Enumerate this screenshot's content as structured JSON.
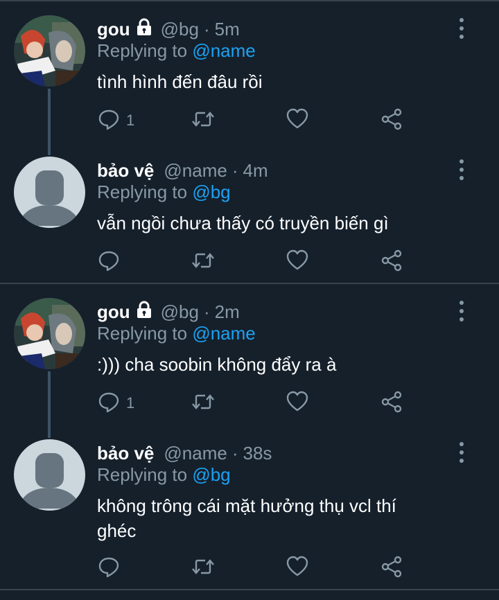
{
  "tweets": [
    {
      "name": "gou",
      "locked": true,
      "avatar": "anime-avatar",
      "handle": "@bg",
      "time": "5m",
      "replying_prefix": "Replying to",
      "replying_to": "@name",
      "text": "tình hình đến đâu rồi",
      "reply_count": "1"
    },
    {
      "name": "bảo vệ",
      "locked": false,
      "avatar": "default-avatar",
      "handle": "@name",
      "time": "4m",
      "replying_prefix": "Replying to",
      "replying_to": "@bg",
      "text": "vẫn ngồi chưa thấy có truyền biến gì",
      "reply_count": ""
    },
    {
      "name": "gou",
      "locked": true,
      "avatar": "anime-avatar",
      "handle": "@bg",
      "time": "2m",
      "replying_prefix": "Replying to",
      "replying_to": "@name",
      "text": ":))) cha soobin không đẩy ra à",
      "reply_count": "1"
    },
    {
      "name": "bảo vệ",
      "locked": false,
      "avatar": "default-avatar",
      "handle": "@name",
      "time": "38s",
      "replying_prefix": "Replying to",
      "replying_to": "@bg",
      "text": "không trông cái mặt hưởng thụ vcl thí ghéc",
      "reply_count": ""
    }
  ],
  "icons": {
    "reply": "reply-icon",
    "retweet": "retweet-icon",
    "like": "heart-icon",
    "share": "share-icon",
    "more": "more-vertical-icon",
    "lock": "lock-icon"
  },
  "colors": {
    "background": "#15202b",
    "divider": "#38444d",
    "muted": "#8899a6",
    "link": "#1da1f2",
    "text": "#ffffff"
  }
}
